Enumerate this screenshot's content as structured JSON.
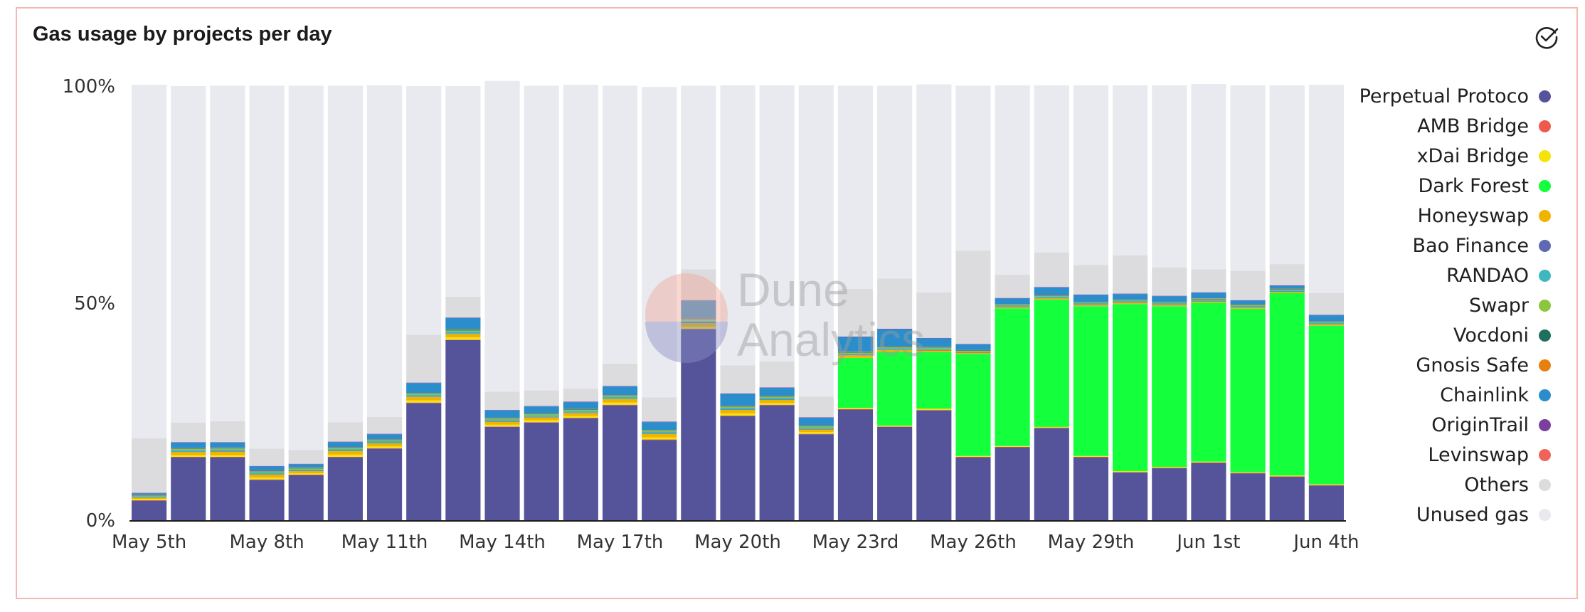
{
  "chart_title": "Gas usage by projects per day",
  "icons": {
    "done": "check-circle-icon"
  },
  "watermark": {
    "line1": "Dune",
    "line2": "Analytics"
  },
  "chart_data": {
    "type": "bar",
    "stacked": true,
    "title": "Gas usage by projects per day",
    "xlabel": "",
    "ylabel": "",
    "ylim": [
      0,
      100
    ],
    "y_format": "percent",
    "y_ticks": [
      "0%",
      "50%",
      "100%"
    ],
    "grid": false,
    "legend_position": "right",
    "categories": [
      "May 5th",
      "May 6th",
      "May 7th",
      "May 8th",
      "May 9th",
      "May 10th",
      "May 11th",
      "May 12th",
      "May 13th",
      "May 14th",
      "May 15th",
      "May 16th",
      "May 17th",
      "May 18th",
      "May 19th",
      "May 20th",
      "May 21st",
      "May 22nd",
      "May 23rd",
      "May 24th",
      "May 25th",
      "May 26th",
      "May 27th",
      "May 28th",
      "May 29th",
      "May 30th",
      "May 31st",
      "Jun 1st",
      "Jun 2nd",
      "Jun 3rd",
      "Jun 4th"
    ],
    "x_tick_labels": [
      "May 5th",
      "May 8th",
      "May 11th",
      "May 14th",
      "May 17th",
      "May 20th",
      "May 23rd",
      "May 26th",
      "May 29th",
      "Jun 1st",
      "Jun 4th"
    ],
    "series": [
      {
        "name": "Perpetual Protoco",
        "color": "#55549a",
        "values": [
          4.5,
          14.5,
          14.5,
          9.3,
          10.4,
          14.5,
          16.5,
          27.0,
          41.5,
          21.5,
          22.5,
          23.5,
          26.5,
          18.5,
          44.0,
          24.0,
          26.5,
          19.8,
          25.5,
          21.5,
          25.3,
          14.5,
          16.8,
          21.2,
          14.5,
          11.0,
          12.0,
          13.2,
          10.8,
          10.0,
          8.0
        ]
      },
      {
        "name": "AMB Bridge",
        "color": "#f05a4a",
        "values": [
          0.1,
          0.1,
          0.1,
          0.1,
          0.1,
          0.1,
          0.1,
          0.1,
          0.1,
          0.1,
          0.1,
          0.1,
          0.1,
          0.1,
          0.1,
          0.1,
          0.1,
          0.1,
          0.1,
          0.1,
          0.1,
          0.1,
          0.1,
          0.1,
          0.1,
          0.1,
          0.1,
          0.1,
          0.1,
          0.1,
          0.1
        ]
      },
      {
        "name": "xDai Bridge",
        "color": "#f5e30a",
        "values": [
          0.3,
          0.4,
          0.4,
          0.4,
          0.3,
          0.5,
          0.4,
          0.5,
          0.5,
          0.4,
          0.4,
          0.4,
          0.5,
          0.5,
          0.5,
          0.5,
          0.4,
          0.4,
          0.3,
          0.2,
          0.3,
          0.2,
          0.2,
          0.2,
          0.2,
          0.2,
          0.2,
          0.2,
          0.2,
          0.2,
          0.2
        ]
      },
      {
        "name": "Dark Forest",
        "color": "#14ff3c",
        "values": [
          0,
          0,
          0,
          0,
          0,
          0,
          0,
          0,
          0,
          0,
          0,
          0,
          0,
          0,
          0,
          0,
          0,
          0,
          11.5,
          17.0,
          13.0,
          23.5,
          31.7,
          29.3,
          34.5,
          38.5,
          37.0,
          36.6,
          37.6,
          42.0,
          36.5
        ]
      },
      {
        "name": "Honeyswap",
        "color": "#f0b400",
        "values": [
          0.3,
          0.7,
          0.8,
          0.7,
          0.5,
          0.8,
          0.7,
          0.8,
          0.8,
          0.7,
          0.7,
          0.7,
          0.8,
          0.8,
          0.8,
          0.8,
          0.7,
          0.6,
          0.6,
          0.4,
          0.4,
          0.3,
          0.3,
          0.3,
          0.3,
          0.3,
          0.3,
          0.3,
          0.3,
          0.3,
          0.3
        ]
      },
      {
        "name": "Bao Finance",
        "color": "#5f68b4",
        "values": [
          0.1,
          0.1,
          0.1,
          0.1,
          0.1,
          0.1,
          0.1,
          0.1,
          0.1,
          0.1,
          0.1,
          0.1,
          0.1,
          0.1,
          0.1,
          0.1,
          0.1,
          0.1,
          0.1,
          0.1,
          0.1,
          0.1,
          0.1,
          0.1,
          0.1,
          0.1,
          0.1,
          0.1,
          0.1,
          0.1,
          0.1
        ]
      },
      {
        "name": "RANDAO",
        "color": "#3eb8be",
        "values": [
          0.2,
          0.4,
          0.4,
          0.3,
          0.3,
          0.4,
          0.4,
          0.4,
          0.5,
          0.4,
          0.4,
          0.4,
          0.4,
          0.4,
          0.5,
          0.4,
          0.4,
          0.4,
          0.3,
          0.3,
          0.3,
          0.2,
          0.3,
          0.3,
          0.3,
          0.3,
          0.3,
          0.3,
          0.3,
          0.3,
          0.3
        ]
      },
      {
        "name": "Swapr",
        "color": "#8cc63e",
        "values": [
          0.1,
          0.2,
          0.2,
          0.2,
          0.2,
          0.2,
          0.2,
          0.2,
          0.2,
          0.2,
          0.2,
          0.2,
          0.2,
          0.2,
          0.2,
          0.2,
          0.2,
          0.2,
          0.2,
          0.2,
          0.2,
          0.1,
          0.1,
          0.1,
          0.1,
          0.1,
          0.1,
          0.1,
          0.1,
          0.1,
          0.1
        ]
      },
      {
        "name": "Vocdoni",
        "color": "#1f6f5f",
        "values": [
          0.1,
          0.1,
          0.1,
          0.1,
          0.1,
          0.1,
          0.1,
          0.1,
          0.2,
          0.1,
          0.1,
          0.1,
          0.1,
          0.1,
          0.1,
          0.1,
          0.1,
          0.1,
          0.1,
          0.1,
          0.1,
          0.1,
          0.1,
          0.1,
          0.1,
          0.1,
          0.1,
          0.1,
          0.1,
          0.1,
          0.1
        ]
      },
      {
        "name": "Gnosis Safe",
        "color": "#e6800f",
        "values": [
          0.1,
          0.1,
          0.1,
          0.1,
          0.1,
          0.1,
          0.1,
          0.1,
          0.1,
          0.1,
          0.1,
          0.1,
          0.1,
          0.1,
          0.1,
          0.1,
          0.1,
          0.1,
          0.1,
          0.1,
          0.1,
          0.1,
          0.1,
          0.1,
          0.1,
          0.1,
          0.1,
          0.1,
          0.1,
          0.1,
          0.1
        ]
      },
      {
        "name": "Chainlink",
        "color": "#2a8ecc",
        "values": [
          0.4,
          1.3,
          1.2,
          1.1,
          0.8,
          1.2,
          1.2,
          2.3,
          2.6,
          1.7,
          1.6,
          1.6,
          2.0,
          1.8,
          4.2,
          2.8,
          1.9,
          1.8,
          3.4,
          4.0,
          2.0,
          1.3,
          1.3,
          1.8,
          1.6,
          1.3,
          1.3,
          1.3,
          0.9,
          0.7,
          1.4
        ]
      },
      {
        "name": "OriginTrail",
        "color": "#7b3fa0",
        "values": [
          0.1,
          0.1,
          0.1,
          0.1,
          0.1,
          0.1,
          0.1,
          0.1,
          0.1,
          0.1,
          0.1,
          0.1,
          0.1,
          0.1,
          0.1,
          0.1,
          0.1,
          0.1,
          0.1,
          0.1,
          0.1,
          0.1,
          0.1,
          0.1,
          0.1,
          0.1,
          0.1,
          0.1,
          0.1,
          0.1,
          0.1
        ]
      },
      {
        "name": "Levinswap",
        "color": "#ee6459",
        "values": [
          0,
          0,
          0,
          0,
          0,
          0,
          0,
          0,
          0,
          0,
          0,
          0,
          0,
          0,
          0,
          0,
          0,
          0,
          0,
          0,
          0,
          0,
          0,
          0,
          0,
          0,
          0,
          0,
          0,
          0,
          0
        ]
      },
      {
        "name": "Others",
        "color": "#dcdcde",
        "values": [
          12.6,
          4.5,
          4.8,
          4.0,
          3.2,
          4.5,
          3.9,
          11.0,
          4.8,
          4.2,
          3.6,
          3.0,
          5.2,
          5.6,
          7.1,
          6.5,
          6.0,
          4.8,
          11.0,
          11.6,
          10.5,
          21.5,
          5.4,
          8.0,
          6.8,
          8.8,
          6.5,
          5.3,
          6.8,
          4.9,
          5.0
        ]
      },
      {
        "name": "Unused gas",
        "color": "#e8eaf0",
        "values": [
          81.4,
          77.5,
          77.3,
          83.6,
          83.9,
          77.5,
          76.4,
          57.3,
          48.5,
          71.6,
          70.2,
          70.0,
          64.0,
          71.5,
          42.3,
          64.5,
          63.6,
          71.7,
          46.8,
          44.4,
          47.9,
          38.0,
          43.6,
          38.5,
          41.4,
          39.2,
          42.0,
          42.7,
          42.7,
          41.2,
          48.0
        ]
      }
    ]
  }
}
